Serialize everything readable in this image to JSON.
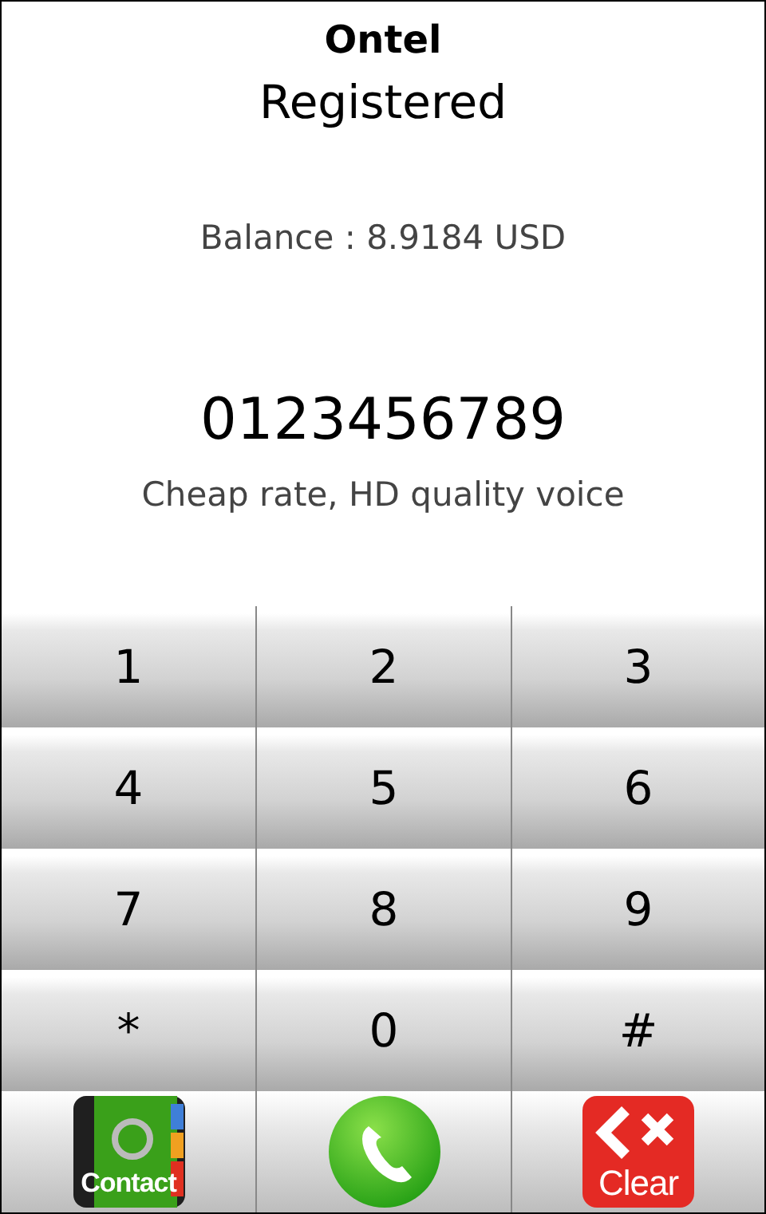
{
  "header": {
    "title": "Ontel",
    "status": "Registered"
  },
  "balance": "Balance : 8.9184 USD",
  "number_display": {
    "value": "0123456789"
  },
  "tagline": "Cheap rate, HD quality voice",
  "keypad": [
    {
      "label": "1"
    },
    {
      "label": "2"
    },
    {
      "label": "3"
    },
    {
      "label": "4"
    },
    {
      "label": "5"
    },
    {
      "label": "6"
    },
    {
      "label": "7"
    },
    {
      "label": "8"
    },
    {
      "label": "9"
    },
    {
      "label": "*"
    },
    {
      "label": "0"
    },
    {
      "label": "#"
    }
  ],
  "actions": [
    {
      "kind": "contact",
      "label": "Contact"
    },
    {
      "kind": "call"
    },
    {
      "kind": "clear",
      "label": "Clear"
    }
  ]
}
